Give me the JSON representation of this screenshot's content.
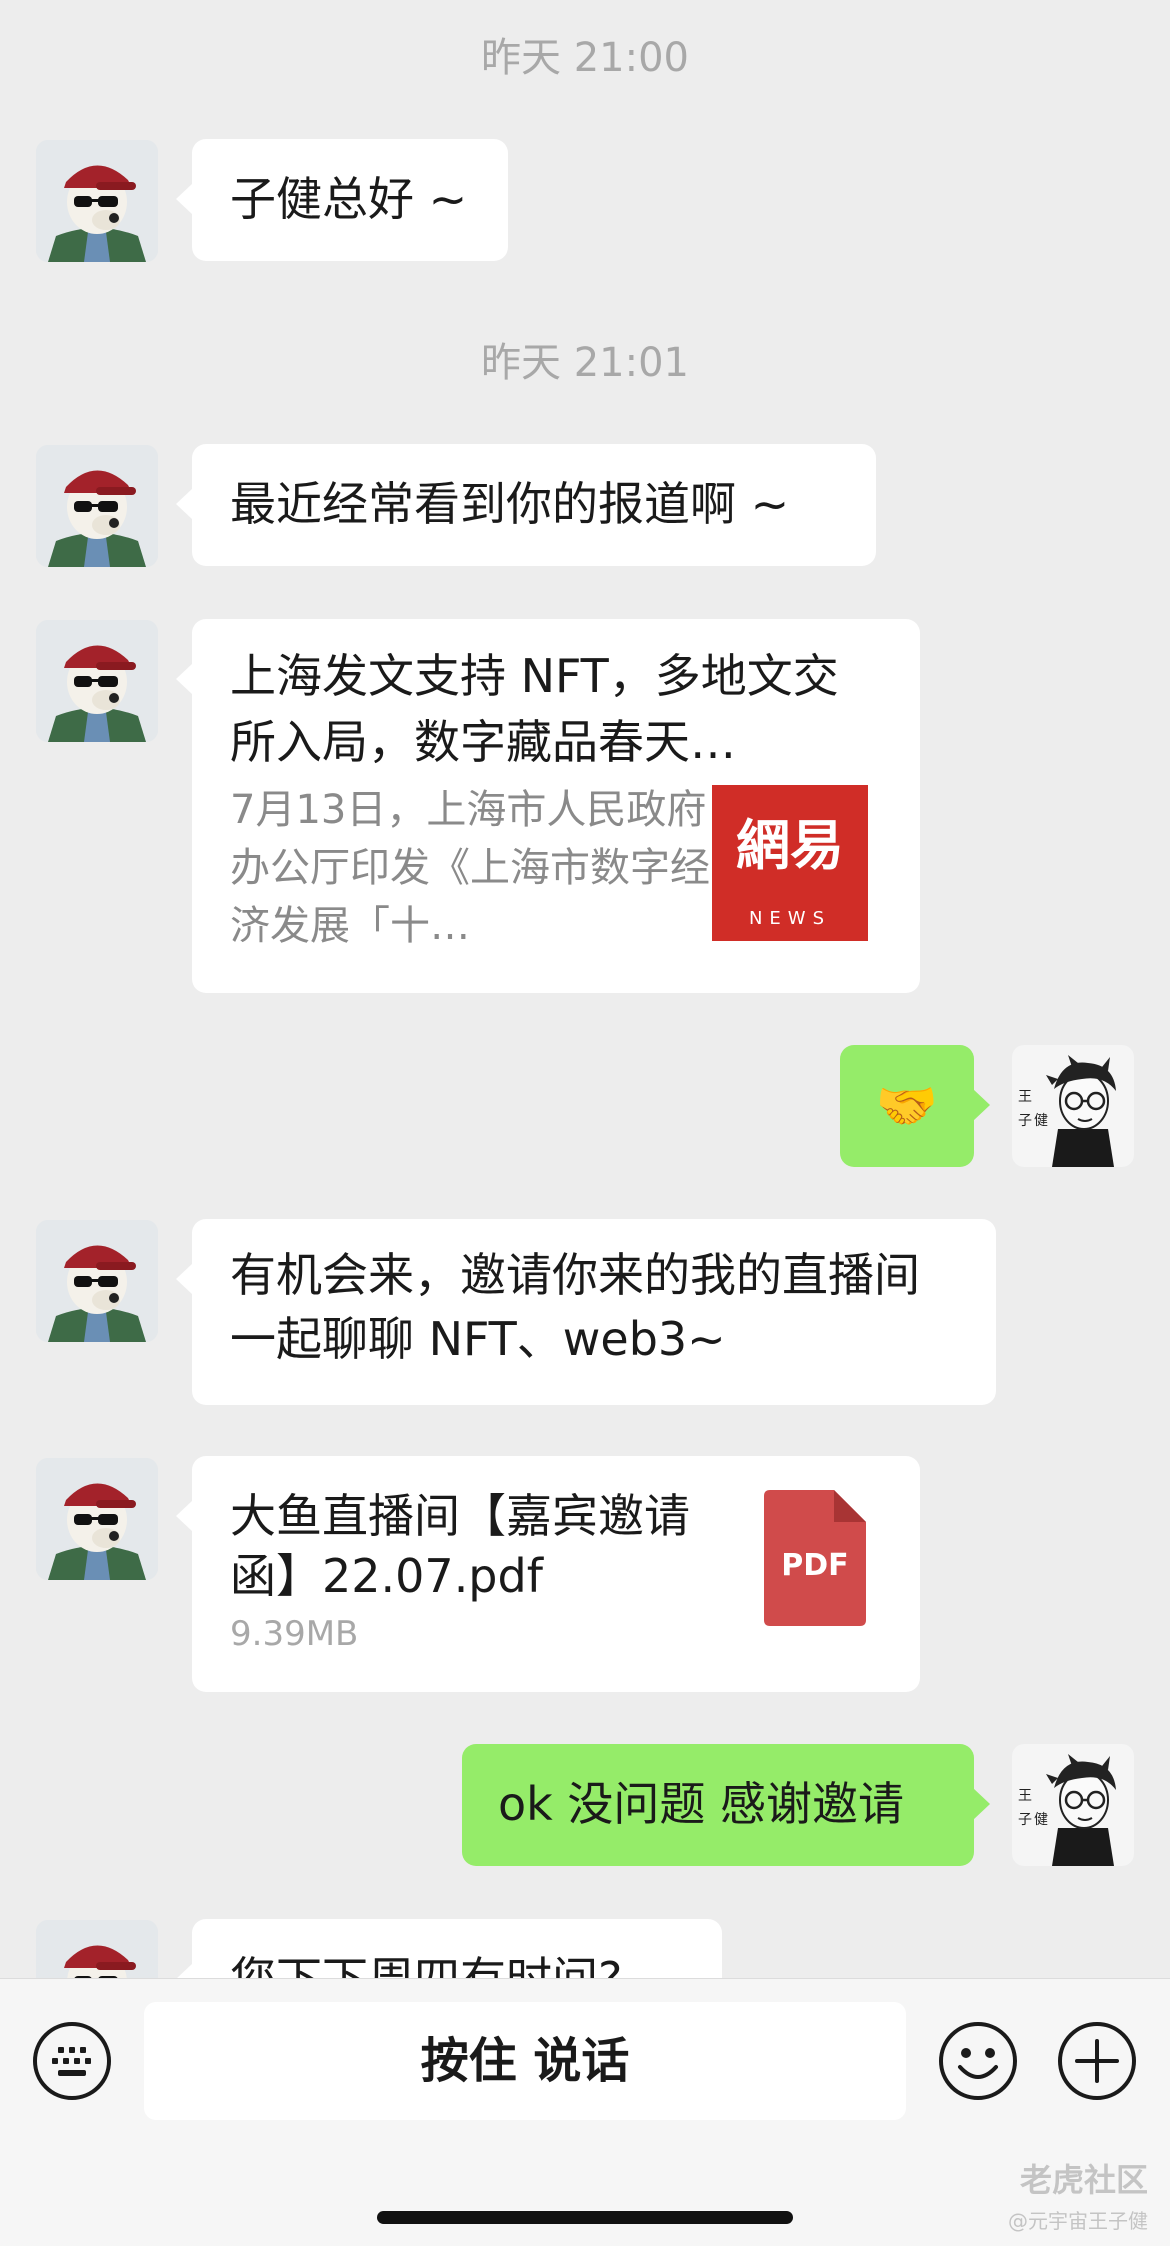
{
  "timestamps": [
    "昨天 21:00",
    "昨天 21:01"
  ],
  "messages": {
    "m1": "子健总好 ~",
    "m2": "最近经常看到你的报道啊 ~",
    "link_card": {
      "title": "上海发文支持 NFT，多地文交所入局，数字藏品春天…",
      "description": "7月13日，上海市人民政府办公厅印发《上海市数字经济发展「十…",
      "source_logo_text": "網易",
      "source_logo_sub": "NEWS"
    },
    "m_handshake": "🤝",
    "m3": "有机会来，邀请你来的我的直播间一起聊聊 NFT、web3~",
    "file_card": {
      "name": "大鱼直播间【嘉宾邀请函】22.07.pdf",
      "size": "9.39MB",
      "icon_label": "PDF"
    },
    "m4": "ok 没问题 感谢邀请",
    "m5_partial": "您下下周四有时间?"
  },
  "input_bar": {
    "talk_button": "按住 说话",
    "icons": [
      "keyboard-icon",
      "emoji-icon",
      "plus-icon"
    ]
  },
  "watermark": {
    "line1": "老虎社区",
    "line2": "@元宇宙王子健"
  },
  "colors": {
    "background": "#ededed",
    "incoming_bubble": "#ffffff",
    "outgoing_bubble": "#95ec69",
    "timestamp": "#a8a8a8",
    "netease_red": "#d02d27",
    "pdf_red": "#d04b4b"
  }
}
